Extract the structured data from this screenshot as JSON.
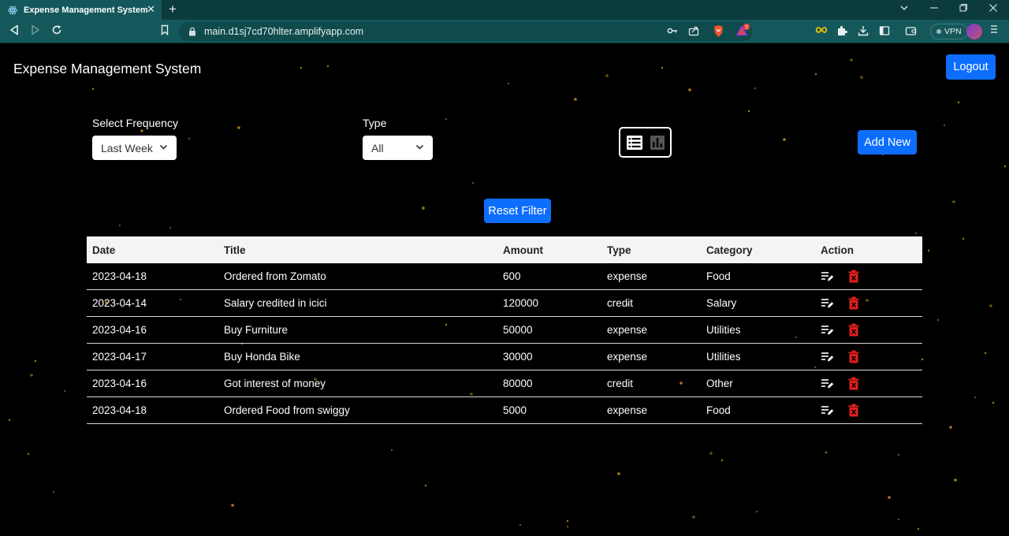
{
  "browser": {
    "tab_title": "Expense Management System",
    "url": "main.d1sj7cd70hlter.amplifyapp.com",
    "vpn_label": "VPN",
    "brave_badge": "7"
  },
  "app": {
    "title": "Expense Management System",
    "logout_label": "Logout",
    "frequency_label": "Select Frequency",
    "frequency_value": "Last Week",
    "type_label": "Type",
    "type_value": "All",
    "add_new_label": "Add New",
    "reset_filter_label": "Reset Filter"
  },
  "table": {
    "headers": [
      "Date",
      "Title",
      "Amount",
      "Type",
      "Category",
      "Action"
    ],
    "rows": [
      {
        "date": "2023-04-18",
        "title": "Ordered from Zomato",
        "amount": "600",
        "type": "expense",
        "category": "Food"
      },
      {
        "date": "2023-04-14",
        "title": "Salary credited in icici",
        "amount": "120000",
        "type": "credit",
        "category": "Salary"
      },
      {
        "date": "2023-04-16",
        "title": "Buy Furniture",
        "amount": "50000",
        "type": "expense",
        "category": "Utilities"
      },
      {
        "date": "2023-04-17",
        "title": "Buy Honda Bike",
        "amount": "30000",
        "type": "expense",
        "category": "Utilities"
      },
      {
        "date": "2023-04-16",
        "title": "Got interest of money",
        "amount": "80000",
        "type": "credit",
        "category": "Other"
      },
      {
        "date": "2023-04-18",
        "title": "Ordered Food from swiggy",
        "amount": "5000",
        "type": "expense",
        "category": "Food"
      }
    ]
  },
  "colors": {
    "primary_button": "#0d6efd",
    "delete_icon": "#e0201b",
    "background": "#000000",
    "browser_chrome": "#14585b",
    "star": "#c8901e"
  },
  "icons": {
    "view_list": "list-view-icon",
    "view_chart": "bar-chart-icon",
    "edit": "edit-icon",
    "delete": "trash-icon"
  }
}
